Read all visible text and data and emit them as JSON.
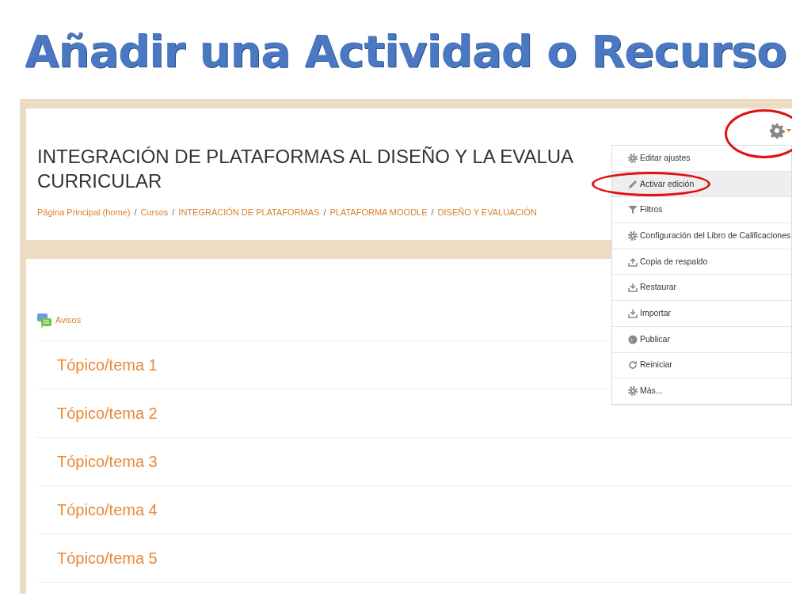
{
  "slide_title": "Añadir una Actividad o Recurso",
  "course": {
    "title_lines": [
      "INTEGRACIÓN DE PLATAFORMAS AL DISEÑO Y LA EVALUA",
      "CURRICULAR"
    ],
    "breadcrumb": [
      "Página Principal (home)",
      "Cursos",
      "INTEGRACIÓN DE PLATAFORMAS",
      "PLATAFORMA MOODLE",
      "DISEÑO Y EVALUACIÓN"
    ],
    "separator": "/"
  },
  "settings_button": {
    "highlighted": true
  },
  "menu": [
    {
      "label": "Editar ajustes",
      "kind": "gear",
      "selected": false,
      "highlighted": false
    },
    {
      "label": "Activar edición",
      "kind": "pencil",
      "selected": true,
      "highlighted": true
    },
    {
      "label": "Filtros",
      "kind": "filter",
      "selected": false,
      "highlighted": false
    },
    {
      "label": "Configuración del Libro de Calificaciones",
      "kind": "gear",
      "selected": false,
      "highlighted": false
    },
    {
      "label": "Copia de respaldo",
      "kind": "upload",
      "selected": false,
      "highlighted": false
    },
    {
      "label": "Restaurar",
      "kind": "download",
      "selected": false,
      "highlighted": false
    },
    {
      "label": "Importar",
      "kind": "download",
      "selected": false,
      "highlighted": false
    },
    {
      "label": "Publicar",
      "kind": "globe",
      "selected": false,
      "highlighted": false
    },
    {
      "label": "Reiniciar",
      "kind": "refresh",
      "selected": false,
      "highlighted": false
    },
    {
      "label": "Más...",
      "kind": "gear",
      "selected": false,
      "highlighted": false
    }
  ],
  "forum": {
    "label": "Avisos"
  },
  "topics": [
    "Tópico/tema 1",
    "Tópico/tema 2",
    "Tópico/tema 3",
    "Tópico/tema 4",
    "Tópico/tema 5"
  ]
}
